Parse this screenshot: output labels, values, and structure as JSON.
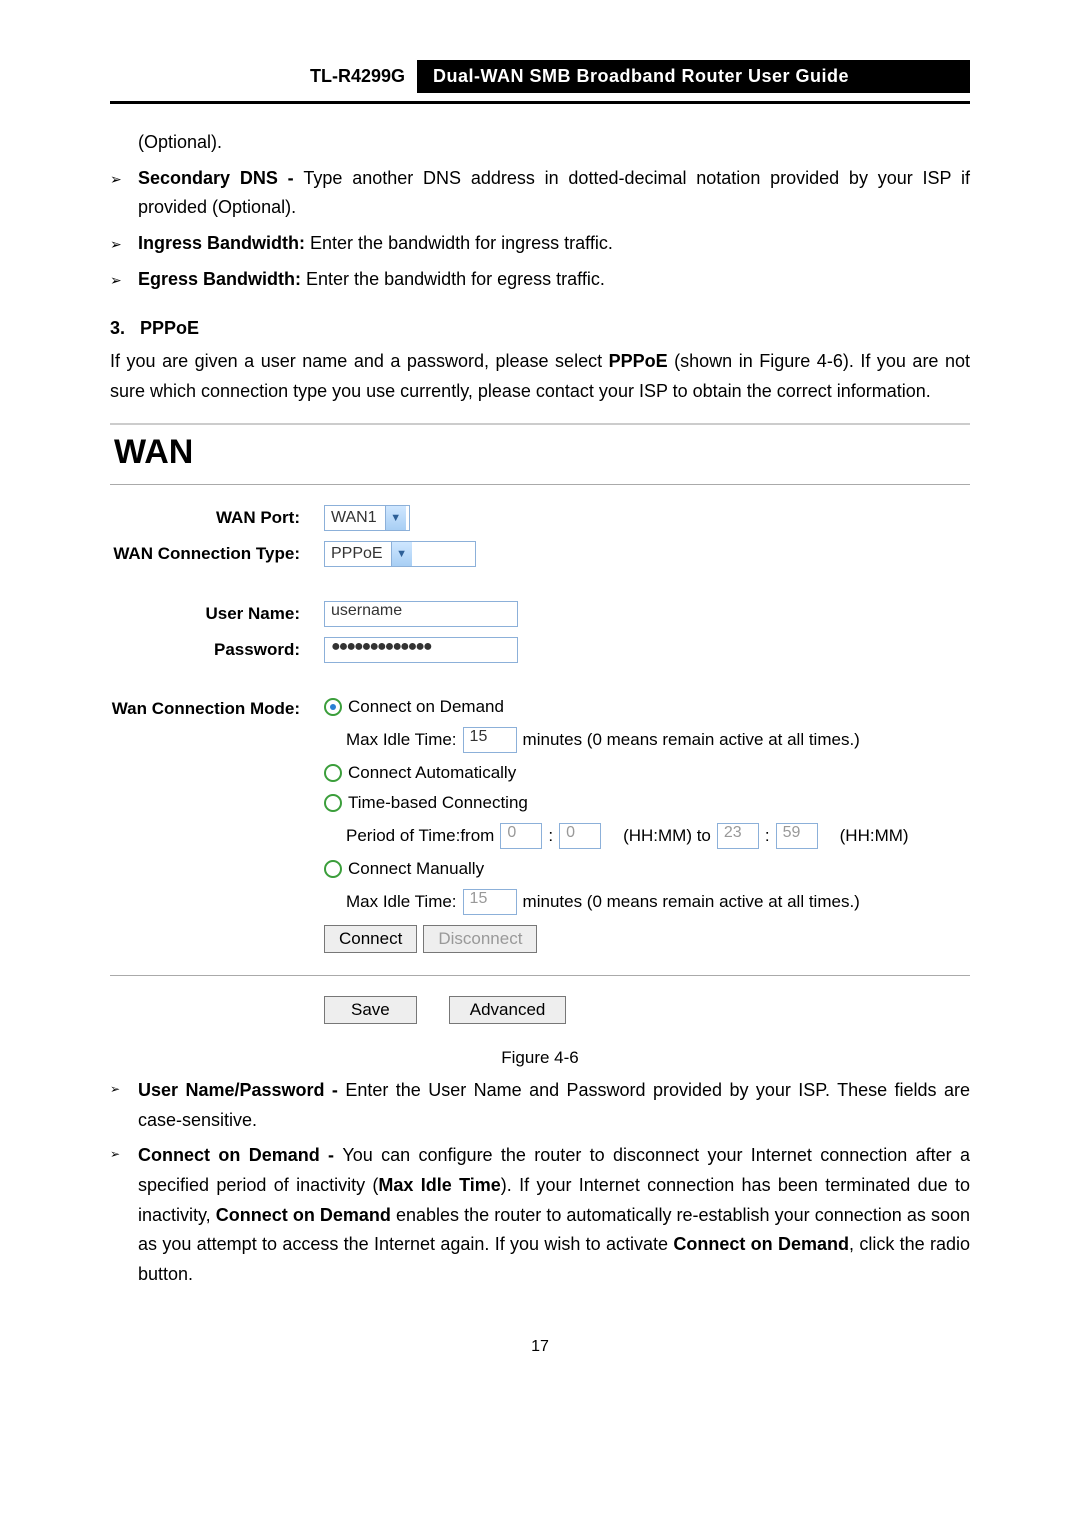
{
  "header": {
    "model": "TL-R4299G",
    "title": "Dual-WAN SMB Broadband Router User Guide"
  },
  "intro": {
    "optional": "(Optional).",
    "secondary_dns_label": "Secondary DNS - ",
    "secondary_dns_text": "Type another DNS address in dotted-decimal notation provided by your ISP if provided (Optional).",
    "ingress_label": "Ingress Bandwidth: ",
    "ingress_text": "Enter the bandwidth for ingress traffic.",
    "egress_label": "Egress Bandwidth: ",
    "egress_text": "Enter the bandwidth for egress traffic."
  },
  "section": {
    "num": "3.",
    "title": "PPPoE",
    "para_a": "If you are given a user name and a password, please select ",
    "para_b": "PPPoE",
    "para_c": " (shown in Figure 4-6). If you are not sure which connection type you use currently, please contact your ISP to obtain the correct information."
  },
  "wan": {
    "heading": "WAN",
    "labels": {
      "wan_port": "WAN Port:",
      "conn_type": "WAN Connection Type:",
      "user_name": "User Name:",
      "password": "Password:",
      "conn_mode": "Wan Connection Mode:"
    },
    "wan_port_value": "WAN1",
    "conn_type_value": "PPPoE",
    "user_name_value": "username",
    "password_value": "●●●●●●●●●●●●●",
    "mode": {
      "on_demand": "Connect on Demand",
      "max_idle_label": "Max Idle Time:",
      "max_idle_value_1": "15",
      "idle_hint": "minutes (0 means remain active at all times.)",
      "auto": "Connect Automatically",
      "time_based": "Time-based Connecting",
      "period_label": "Period of Time:from",
      "period_from_h": "0",
      "period_from_m": "0",
      "period_hhmm_to": "(HH:MM) to",
      "period_to_h": "23",
      "period_to_m": "59",
      "period_hhmm": "(HH:MM)",
      "manual": "Connect Manually",
      "max_idle_value_2": "15",
      "connect_btn": "Connect",
      "disconnect_btn": "Disconnect"
    },
    "save_btn": "Save",
    "advanced_btn": "Advanced"
  },
  "figure_caption": "Figure 4-6",
  "post": {
    "up_label": "User Name/Password - ",
    "up_text": "Enter the User Name and Password provided by your ISP. These fields are case-sensitive.",
    "cod_label": "Connect on Demand - ",
    "cod_text_a": "You can configure the router to disconnect your Internet connection after a specified period of inactivity (",
    "cod_text_b": "Max Idle Time",
    "cod_text_c": "). If your Internet connection has been terminated due to inactivity, ",
    "cod_text_d": "Connect on Demand",
    "cod_text_e": " enables the router to automatically re-establish your connection as soon as you attempt to access the Internet again. If you wish to activate ",
    "cod_text_f": "Connect on Demand",
    "cod_text_g": ", click the radio button."
  },
  "page_number": "17"
}
